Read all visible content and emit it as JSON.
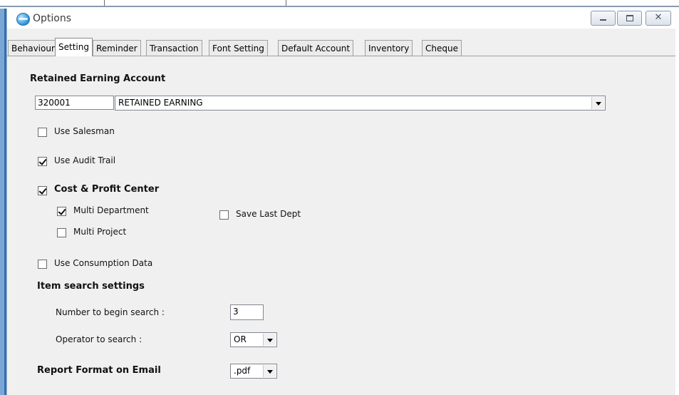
{
  "window": {
    "title": "Options",
    "controls": {
      "minimize": "",
      "maximize": "",
      "close": "✕"
    }
  },
  "tabs": [
    {
      "label": "Behaviour",
      "active": false
    },
    {
      "label": "Setting",
      "active": true
    },
    {
      "label": "Reminder",
      "active": false
    },
    {
      "label": "Transaction",
      "active": false
    },
    {
      "label": "Font Setting",
      "active": false
    },
    {
      "label": "Default Account",
      "active": false
    },
    {
      "label": "Inventory",
      "active": false
    },
    {
      "label": "Cheque",
      "active": false
    }
  ],
  "retained": {
    "title": "Retained Earning Account",
    "code": "320001",
    "name": "RETAINED EARNING"
  },
  "options": {
    "use_salesman": {
      "label": "Use Salesman",
      "checked": false
    },
    "use_audit_trail": {
      "label": "Use Audit Trail",
      "checked": true
    },
    "cost_profit_center": {
      "label": "Cost & Profit Center",
      "checked": true
    },
    "multi_department": {
      "label": "Multi Department",
      "checked": true
    },
    "save_last_dept": {
      "label": "Save Last Dept",
      "checked": false
    },
    "multi_project": {
      "label": "Multi Project",
      "checked": false
    },
    "use_consumption_data": {
      "label": "Use Consumption Data",
      "checked": false
    }
  },
  "item_search": {
    "title": "Item search settings",
    "number_label": "Number to begin search :",
    "number_value": "3",
    "operator_label": "Operator to search :",
    "operator_value": "OR"
  },
  "report": {
    "label": "Report Format on Email",
    "value": ".pdf"
  },
  "colors": {
    "window_bg": "#f0f0f0",
    "accent": "#2f6fb4"
  }
}
